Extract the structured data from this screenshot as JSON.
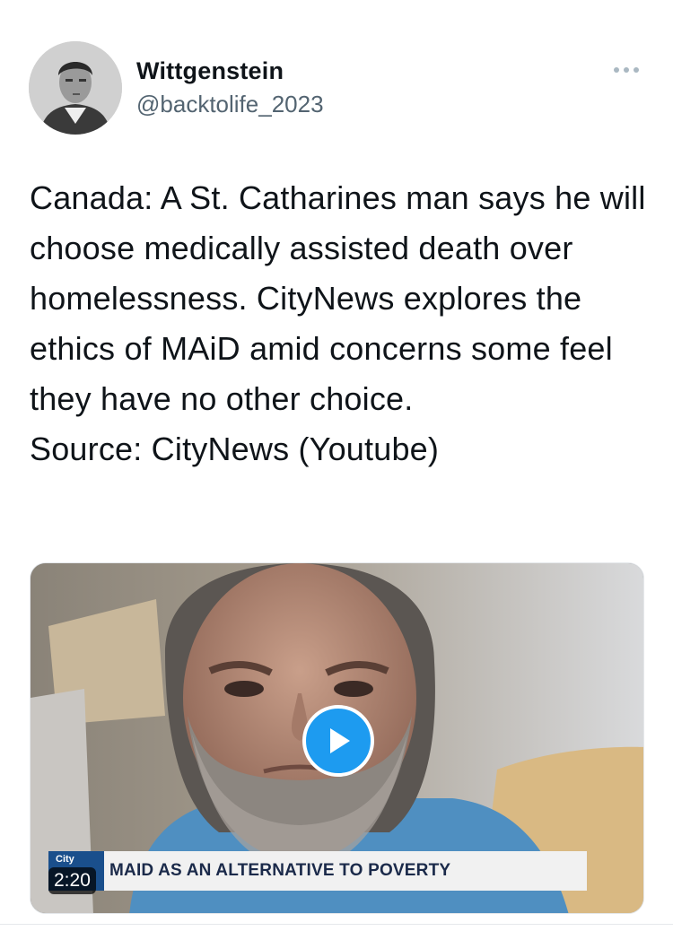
{
  "author": {
    "display_name": "Wittgenstein",
    "handle": "@backtolife_2023",
    "avatar_icon": "portrait-photo"
  },
  "more_icon": "more-dots-icon",
  "tweet": {
    "lines": [
      "Canada: A St. Catharines man says he will choose medically assisted death over homelessness. CityNews explores the ethics of MAiD amid concerns some feel they have no other choice.",
      "Source: CityNews (Youtube)"
    ]
  },
  "media": {
    "type": "video",
    "duration": "2:20",
    "station_logo": "City",
    "headline": "MAID AS AN ALTERNATIVE TO POVERTY",
    "play_icon": "play-icon"
  },
  "colors": {
    "accent": "#1d9bf0",
    "text": "#0f1419",
    "secondary": "#536471"
  }
}
